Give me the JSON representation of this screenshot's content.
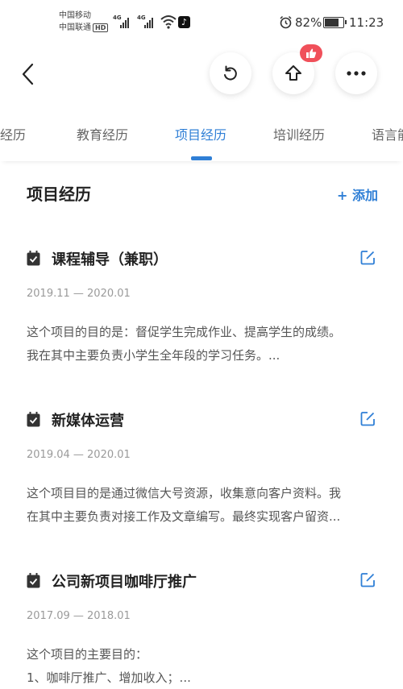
{
  "status_bar": {
    "carrier_1": "中国移动",
    "carrier_2": "中国联通",
    "hd_badge": "HD",
    "network_1": "4G",
    "network_2": "4G",
    "battery_percent": "82%",
    "battery_level": 0.82,
    "time": "11:23"
  },
  "toolbar": {
    "back_icon": "chevron-left-icon",
    "refresh_icon": "rotate-left-icon",
    "share_icon": "share-up-arrow-icon",
    "like_badge_icon": "thumbs-up-icon",
    "more_icon": "ellipsis-icon"
  },
  "tabs": [
    {
      "label": "工作经历",
      "active": false
    },
    {
      "label": "教育经历",
      "active": false
    },
    {
      "label": "项目经历",
      "active": true
    },
    {
      "label": "培训经历",
      "active": false
    },
    {
      "label": "语言能力",
      "active": false
    }
  ],
  "section": {
    "title": "项目经历",
    "add_label": "+ 添加"
  },
  "entries": [
    {
      "title": "课程辅导（兼职）",
      "date": "2019.11 — 2020.01",
      "lines": [
        "这个项目的目的是：督促学生完成作业、提高学生的成绩。",
        "我在其中主要负责小学生全年段的学习任务。..."
      ]
    },
    {
      "title": "新媒体运营",
      "date": "2019.04 — 2020.01",
      "lines": [
        "这个项目目的是通过微信大号资源，收集意向客户资料。我",
        "在其中主要负责对接工作及文章编写。最终实现客户留资..."
      ]
    },
    {
      "title": "公司新项目咖啡厅推广",
      "date": "2017.09 — 2018.01",
      "lines": [
        "这个项目的主要目的：",
        "1、咖啡厅推广、增加收入；..."
      ]
    }
  ],
  "colors": {
    "accent": "#2f7fd6",
    "badge": "#f0505a",
    "text": "#222222",
    "muted": "#9a9a9a"
  }
}
